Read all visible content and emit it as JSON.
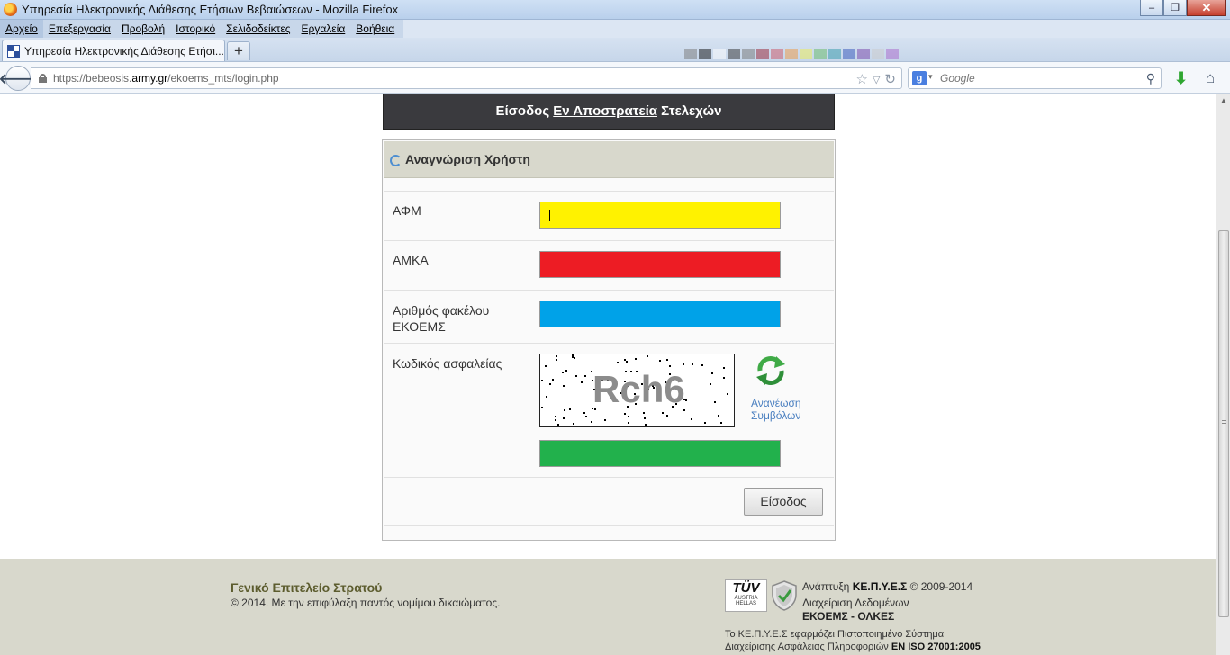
{
  "window": {
    "title": "Υπηρεσία Ηλεκτρονικής Διάθεσης Ετήσιων Βεβαιώσεων - Mozilla Firefox",
    "buttons": {
      "minimize": "‒",
      "maximize": "❐",
      "close": "✕"
    }
  },
  "menu": [
    "Αρχείο",
    "Επεξεργασία",
    "Προβολή",
    "Ιστορικό",
    "Σελιδοδείκτες",
    "Εργαλεία",
    "Βοήθεια"
  ],
  "tab": {
    "label": "Υπηρεσία Ηλεκτρονικής Διάθεσης Ετήσι...",
    "new_tab": "+"
  },
  "nav": {
    "url_prefix": "https://bebeosis.",
    "url_host": "army.gr",
    "url_path": "/ekoems_mts/login.php",
    "search_placeholder": "Google",
    "icons": [
      "back-arrow-icon",
      "lock-icon",
      "star-icon",
      "dropdown-icon",
      "reload-icon",
      "google-icon",
      "search-icon",
      "download-icon",
      "home-icon"
    ]
  },
  "page": {
    "header": {
      "pre": "Είσοδος ",
      "link": "Εν Αποστρατεία",
      "post": " Στελεχών"
    },
    "form_title": "Αναγνώριση Χρήστη",
    "fields": {
      "afm": {
        "label": "ΑΦΜ",
        "value": ""
      },
      "amka": {
        "label": "ΑΜΚΑ",
        "value": ""
      },
      "file_no": {
        "label_line1": "Αριθμός φακέλου",
        "label_line2": "ΕΚΟΕΜΣ",
        "value": ""
      },
      "security_code": {
        "label": "Κωδικός ασφαλείας",
        "value": ""
      }
    },
    "captcha": {
      "text": "Rch6",
      "refresh_label_line1": "Ανανέωση",
      "refresh_label_line2": "Συμβόλων"
    },
    "submit": "Είσοδος",
    "field_colors": {
      "afm": "#fff200",
      "amka": "#ed1c24",
      "file_no": "#00a2e8",
      "security_code": "#22b14c"
    }
  },
  "footer": {
    "org": "Γενικό Επιτελείο Στρατού",
    "copyright": "© 2014. Με την επιφύλαξη παντός νομίμου δικαιώματος.",
    "tuv": "TÜV",
    "tuv_sub1": "AUSTRIA",
    "tuv_sub2": "HELLAS",
    "dev_pre": "Ανάπτυξη ",
    "dev_org": "ΚΕ.Π.Υ.Ε.Σ",
    "dev_post": " © 2009-2014",
    "data_mgmt": "Διαχείριση Δεδομένων",
    "data_org": "ΕΚΟΕΜΣ - ΟΛΚΕΣ",
    "iso_line1": "Το ΚΕ.Π.Υ.Ε.Σ εφαρμόζει Πιστοποιημένο Σύστημα",
    "iso_line2_pre": "Διαχείρισης Ασφάλειας Πληροφοριών ",
    "iso_line2_std": "EN ISO 27001:2005"
  }
}
